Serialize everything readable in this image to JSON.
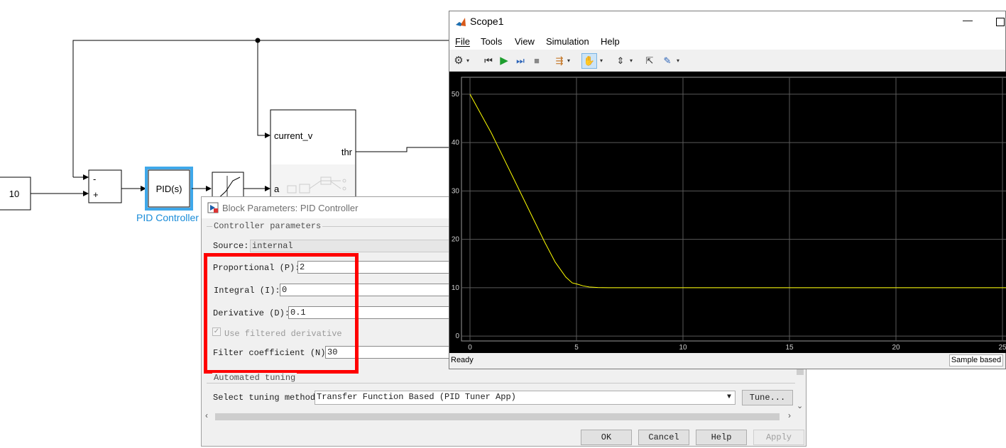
{
  "model": {
    "constant_value": "10",
    "sum_signs": [
      "-",
      "+"
    ],
    "pid_block_label": "PID(s)",
    "pid_block_name": "PID Controller",
    "subsystem_ports": {
      "in1": "current_v",
      "in2": "a",
      "out1": "thr"
    }
  },
  "dialog": {
    "title": "Block Parameters: PID Controller",
    "group_controller": "Controller parameters",
    "source_label": "Source:",
    "source_value": "internal",
    "p_label": "Proportional (P):",
    "p_value": "2",
    "i_label": "Integral (I):",
    "i_value": "0",
    "d_label": "Derivative (D):",
    "d_value": "0.1",
    "filtered_label": "Use filtered derivative",
    "filtered_checked": true,
    "n_label": "Filter coefficient (N):",
    "n_value": "30",
    "group_tuning": "Automated tuning",
    "tuning_label": "Select tuning method:",
    "tuning_value": "Transfer Function Based (PID Tuner App)",
    "tune_button": "Tune...",
    "buttons": {
      "ok": "OK",
      "cancel": "Cancel",
      "help": "Help",
      "apply": "Apply"
    },
    "highlight_color": "#ff0000"
  },
  "scope": {
    "title": "Scope1",
    "menu": [
      "File",
      "Tools",
      "View",
      "Simulation",
      "Help"
    ],
    "status_text": "Ready",
    "sample_mode": "Sample based",
    "toolbar_icons": [
      "gear-icon",
      "rewind-icon",
      "run-icon",
      "step-forward-icon",
      "stop-icon",
      "highlight-icon",
      "pan-icon",
      "scale-icon",
      "restore-icon",
      "style-icon"
    ]
  },
  "chart_data": {
    "type": "line",
    "x_ticks": [
      0,
      5,
      10,
      15,
      20,
      25
    ],
    "y_ticks": [
      0,
      10,
      20,
      30,
      40,
      50
    ],
    "xlim": [
      -0.4,
      25.2
    ],
    "ylim": [
      -1,
      53.5
    ],
    "grid": true,
    "series": [
      {
        "color": "#ffff00",
        "x": [
          0,
          0.5,
          1,
          1.5,
          2,
          2.5,
          3,
          3.5,
          4,
          4.5,
          4.8,
          5,
          5.3,
          5.6,
          6,
          6.5,
          8,
          10,
          15,
          20,
          25.2
        ],
        "y": [
          50,
          46,
          42,
          37.5,
          33,
          28.5,
          24,
          19.5,
          15.3,
          12.2,
          11,
          10.8,
          10.4,
          10.15,
          10.05,
          10,
          10,
          10,
          10,
          10,
          10
        ]
      }
    ]
  }
}
